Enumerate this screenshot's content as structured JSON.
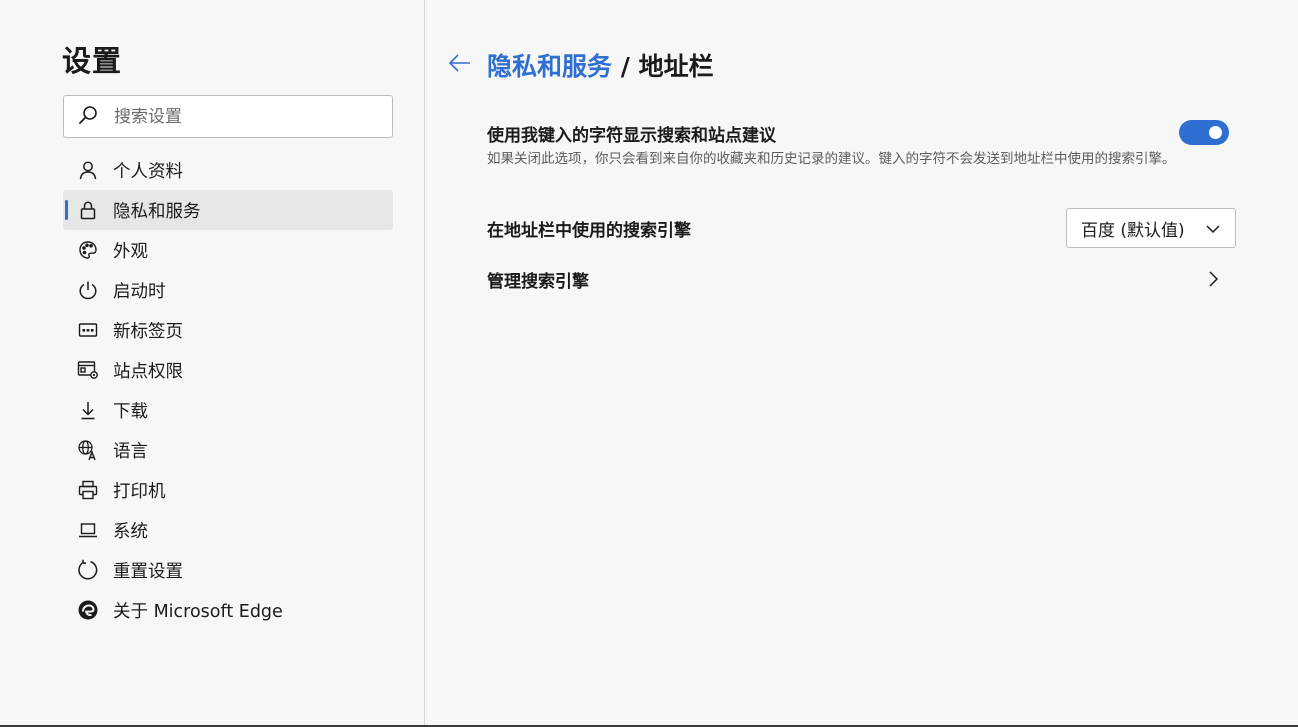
{
  "sidebar": {
    "title": "设置",
    "search": {
      "placeholder": "搜索设置",
      "value": ""
    },
    "items": [
      {
        "label": "个人资料",
        "icon": "person-icon"
      },
      {
        "label": "隐私和服务",
        "icon": "lock-icon",
        "active": true
      },
      {
        "label": "外观",
        "icon": "palette-icon"
      },
      {
        "label": "启动时",
        "icon": "power-icon"
      },
      {
        "label": "新标签页",
        "icon": "new-tab-icon"
      },
      {
        "label": "站点权限",
        "icon": "site-permissions-icon"
      },
      {
        "label": "下载",
        "icon": "download-icon"
      },
      {
        "label": "语言",
        "icon": "language-icon"
      },
      {
        "label": "打印机",
        "icon": "printer-icon"
      },
      {
        "label": "系统",
        "icon": "laptop-icon"
      },
      {
        "label": "重置设置",
        "icon": "reset-icon"
      },
      {
        "label": "关于 Microsoft Edge",
        "icon": "edge-logo-icon"
      }
    ]
  },
  "main": {
    "breadcrumb": {
      "parent": "隐私和服务",
      "separator": " / ",
      "current": "地址栏"
    },
    "suggestions": {
      "title": "使用我键入的字符显示搜索和站点建议",
      "description": "如果关闭此选项，你只会看到来自你的收藏夹和历史记录的建议。键入的字符不会发送到地址栏中使用的搜索引擎。",
      "enabled": true
    },
    "search_engine": {
      "title": "在地址栏中使用的搜索引擎",
      "selected": "百度 (默认值)"
    },
    "manage": {
      "title": "管理搜索引擎"
    }
  },
  "colors": {
    "accent": "#2f6fd1",
    "background": "#f7f7f7",
    "active_item": "#e6e6e6"
  }
}
